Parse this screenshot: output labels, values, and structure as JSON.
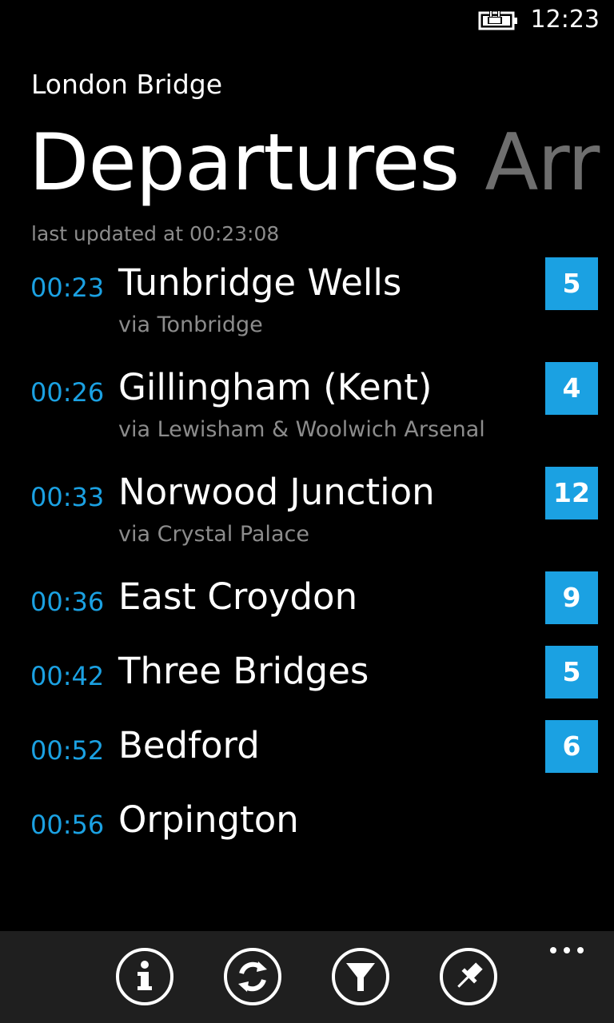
{
  "status_bar": {
    "clock": "12:23",
    "battery_icon": "battery-charging-icon"
  },
  "header": {
    "station": "London Bridge",
    "pivot_active": "Departures",
    "pivot_next": "Arr",
    "last_updated": "last updated at 00:23:08"
  },
  "departures": [
    {
      "time": "00:23",
      "destination": "Tunbridge Wells",
      "via": "via Tonbridge",
      "platform": "5"
    },
    {
      "time": "00:26",
      "destination": "Gillingham (Kent)",
      "via": "via Lewisham & Woolwich Arsenal",
      "platform": "4"
    },
    {
      "time": "00:33",
      "destination": "Norwood Junction",
      "via": "via Crystal Palace",
      "platform": "12"
    },
    {
      "time": "00:36",
      "destination": "East Croydon",
      "via": "",
      "platform": "9"
    },
    {
      "time": "00:42",
      "destination": "Three Bridges",
      "via": "",
      "platform": "5"
    },
    {
      "time": "00:52",
      "destination": "Bedford",
      "via": "",
      "platform": "6"
    },
    {
      "time": "00:56",
      "destination": "Orpington",
      "via": "",
      "platform": ""
    }
  ],
  "app_bar": {
    "buttons": [
      "info-icon",
      "refresh-icon",
      "filter-icon",
      "pin-icon"
    ],
    "more_icon": "ellipsis-icon"
  },
  "colors": {
    "accent": "#1ba1e2",
    "background": "#000000",
    "subtle_text": "#8c8c8c",
    "inactive_pivot": "#6e6e6e",
    "app_bar": "#1f1f1f"
  }
}
